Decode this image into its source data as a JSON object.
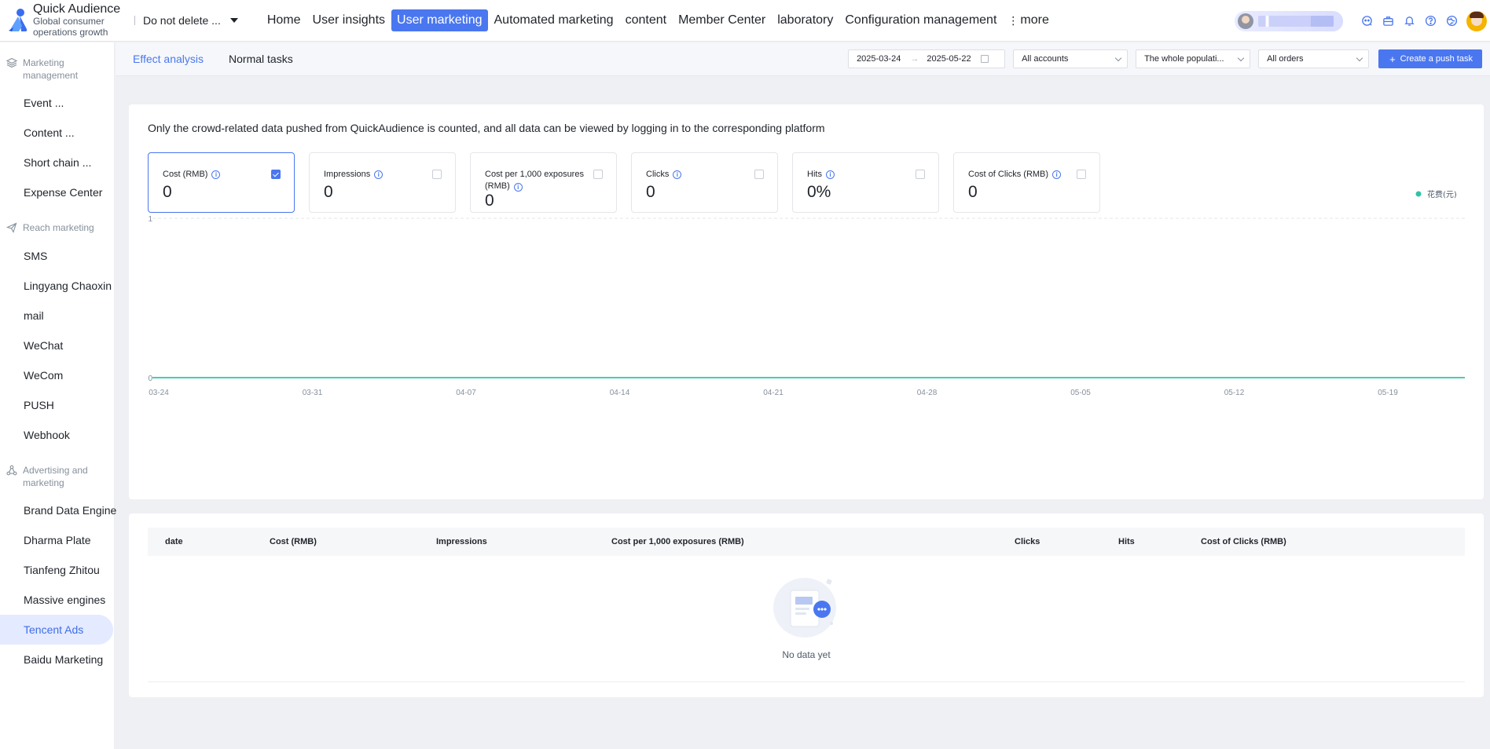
{
  "brand": {
    "name": "Quick Audience",
    "subtitle_line1": "Global consumer",
    "subtitle_line2": "operations growth"
  },
  "workspace": {
    "label": "Do not delete ..."
  },
  "nav": {
    "items": [
      "Home",
      "User insights",
      "User marketing",
      "Automated marketing",
      "content",
      "Member Center",
      "laboratory",
      "Configuration management"
    ],
    "active": "User marketing",
    "more_label": "more"
  },
  "top_icons": [
    "robot-icon",
    "briefcase-icon",
    "bell-icon",
    "help-icon",
    "globe-icon"
  ],
  "sidebar": {
    "groups": [
      {
        "label": "Marketing management",
        "icon": "layers-icon",
        "items": [
          "Event ...",
          "Content ...",
          "Short chain ...",
          "Expense Center"
        ]
      },
      {
        "label": "Reach marketing",
        "icon": "send-icon",
        "items": [
          "SMS",
          "Lingyang Chaoxin",
          "mail",
          "WeChat",
          "WeCom",
          "PUSH",
          "Webhook"
        ]
      },
      {
        "label": "Advertising and marketing",
        "icon": "share-icon",
        "items": [
          "Brand Data Engine",
          "Dharma Plate",
          "Tianfeng Zhitou",
          "Massive engines",
          "Tencent Ads",
          "Baidu Marketing"
        ]
      }
    ],
    "active_item": "Tencent Ads"
  },
  "tabs": [
    {
      "label": "Effect analysis",
      "active": true
    },
    {
      "label": "Normal tasks",
      "active": false
    }
  ],
  "filters": {
    "date_start": "2025-03-24",
    "date_end": "2025-05-22",
    "accounts": "All accounts",
    "population": "The whole populati...",
    "orders": "All orders",
    "create_button": "Create a push task"
  },
  "notice": "Only the crowd-related data pushed from QuickAudience is counted, and all data can be viewed by logging in to the corresponding platform",
  "metrics": [
    {
      "label": "Cost (RMB)",
      "value": "0",
      "checked": true,
      "info": true
    },
    {
      "label": "Impressions",
      "value": "0",
      "checked": false,
      "info": true
    },
    {
      "label": "Cost per 1,000 exposures (RMB)",
      "value": "0",
      "checked": false,
      "info": true
    },
    {
      "label": "Clicks",
      "value": "0",
      "checked": false,
      "info": true
    },
    {
      "label": "Hits",
      "value": "0%",
      "checked": false,
      "info": true
    },
    {
      "label": "Cost of Clicks (RMB)",
      "value": "0",
      "checked": false,
      "info": true
    }
  ],
  "chart_data": {
    "type": "line",
    "title": "",
    "xlabel": "",
    "ylabel": "",
    "categories": [
      "03-24",
      "03-31",
      "04-07",
      "04-14",
      "04-21",
      "04-28",
      "05-05",
      "05-12",
      "05-19"
    ],
    "ylim": [
      0,
      1
    ],
    "y_ticks": [
      "0",
      "1"
    ],
    "grid": true,
    "legend_position": "top-right",
    "series": [
      {
        "name": "花费(元)",
        "values": [
          0,
          0,
          0,
          0,
          0,
          0,
          0,
          0,
          0
        ],
        "color": "#2fc4a6"
      }
    ]
  },
  "table": {
    "columns": [
      "date",
      "Cost (RMB)",
      "Impressions",
      "Cost per 1,000 exposures (RMB)",
      "Clicks",
      "Hits",
      "Cost of Clicks (RMB)"
    ],
    "rows": [],
    "empty_text": "No data yet"
  },
  "colors": {
    "accent": "#4a77f0",
    "series": "#2fc4a6",
    "background": "#eef0f4"
  }
}
